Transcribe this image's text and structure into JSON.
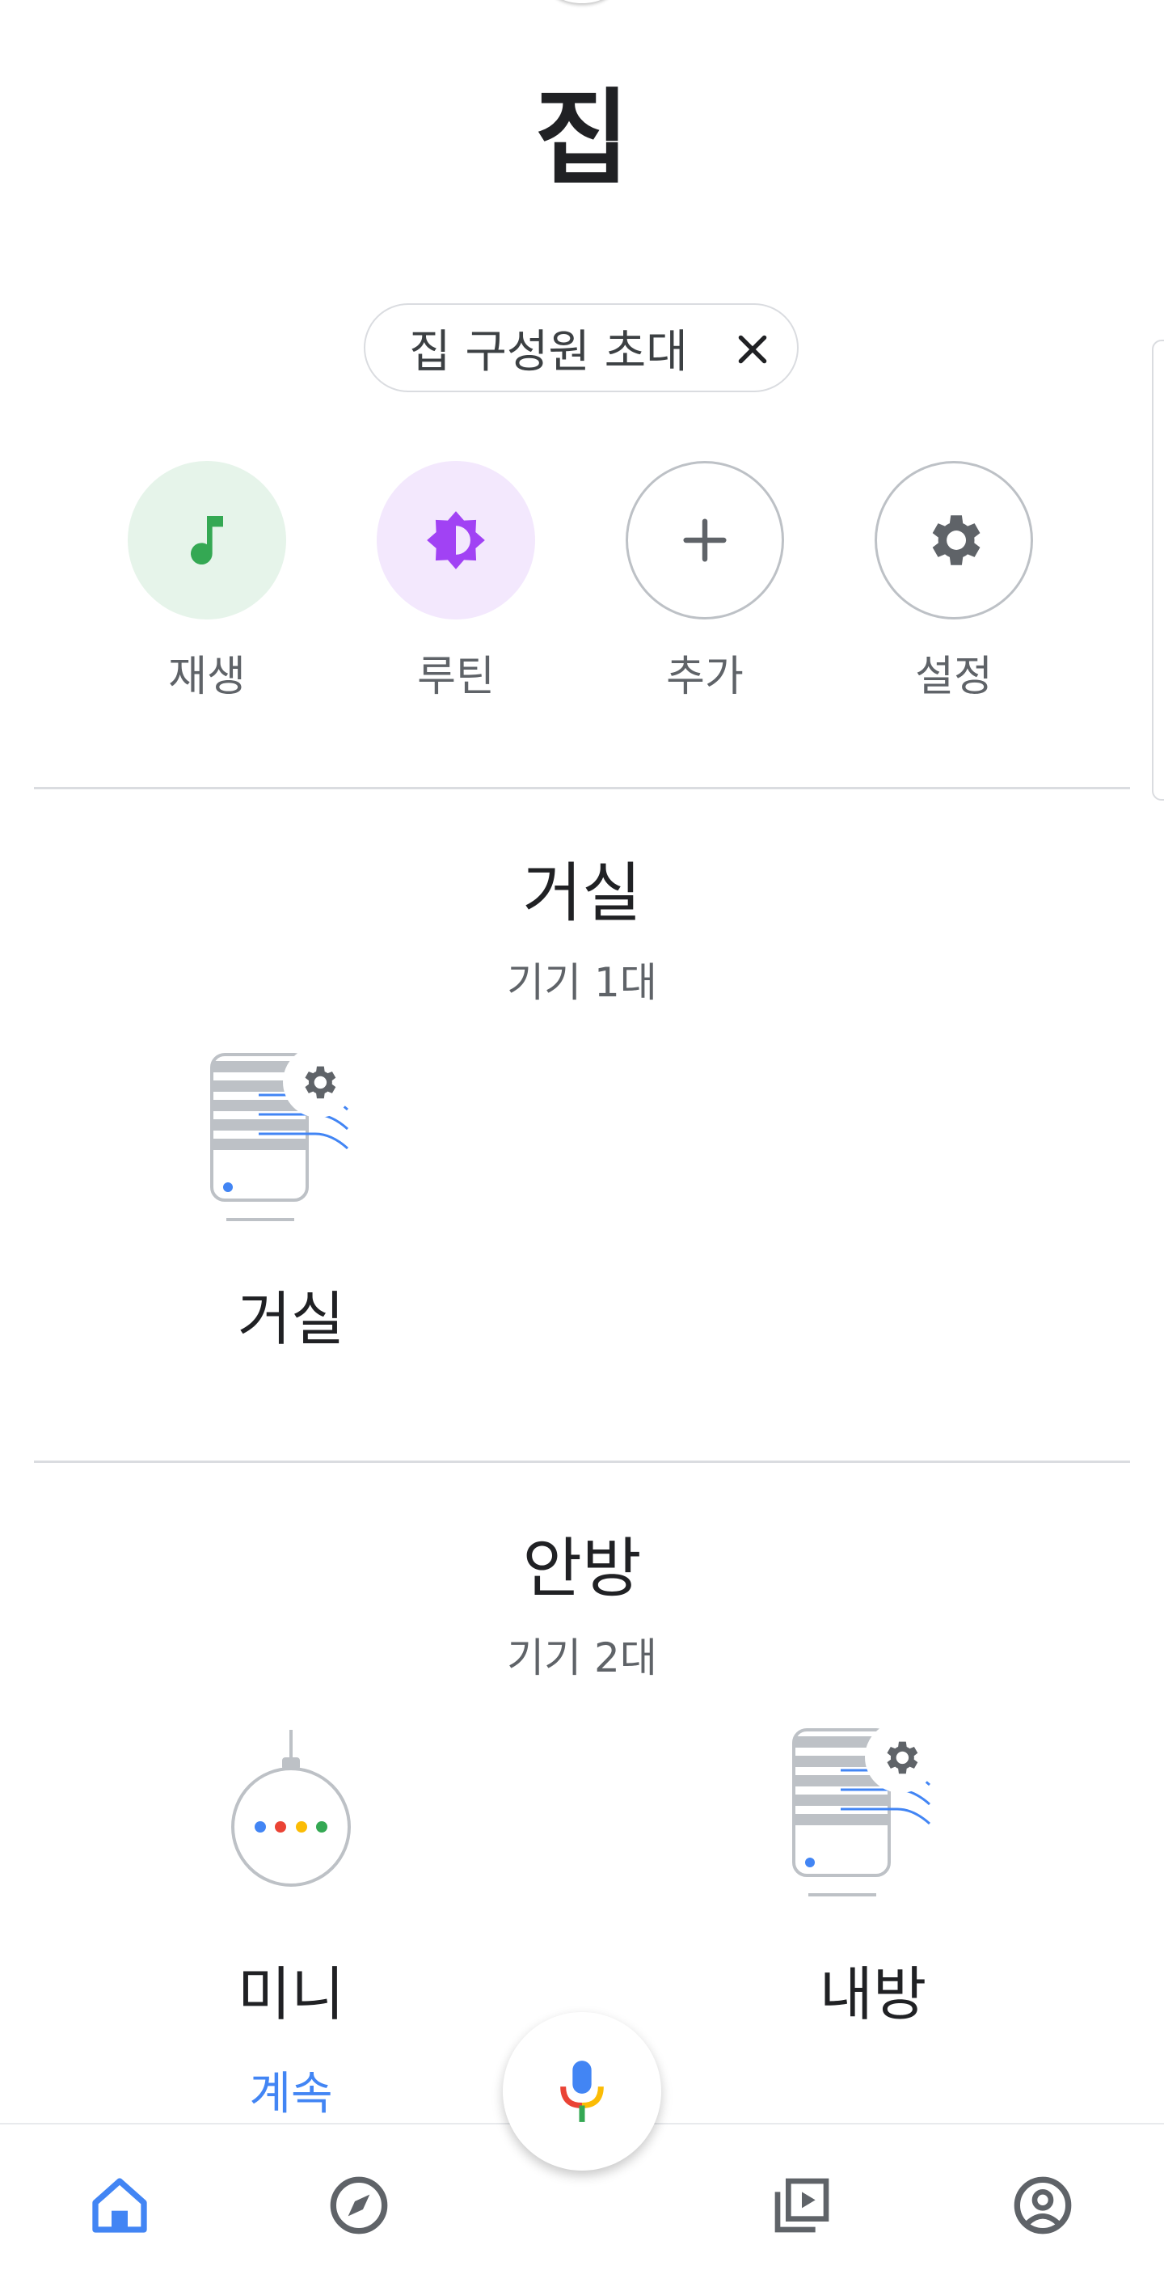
{
  "header": {
    "title": "집"
  },
  "invite_chip": {
    "label": "집 구성원 초대"
  },
  "actions": [
    {
      "label": "재생",
      "icon": "music-note-icon",
      "color": "#34a853"
    },
    {
      "label": "루틴",
      "icon": "brightness-icon",
      "color": "#a142f4"
    },
    {
      "label": "추가",
      "icon": "plus-icon",
      "color": "#5f6368"
    },
    {
      "label": "설정",
      "icon": "gear-icon",
      "color": "#5f6368"
    }
  ],
  "rooms": [
    {
      "title": "거실",
      "count": "기기 1대",
      "devices": [
        {
          "name": "거실",
          "icon": "speaker-group-icon"
        }
      ]
    },
    {
      "title": "안방",
      "count": "기기 2대",
      "devices": [
        {
          "name": "미니",
          "icon": "google-home-mini-icon",
          "link": "계속"
        },
        {
          "name": "내방",
          "icon": "speaker-group-icon"
        }
      ]
    }
  ],
  "bottom_nav": {
    "items": [
      "home-icon",
      "explore-icon",
      "media-icon",
      "account-icon"
    ],
    "active_color": "#4285f4",
    "inactive_color": "#5f6368"
  },
  "mic": {
    "icon": "mic-icon"
  }
}
